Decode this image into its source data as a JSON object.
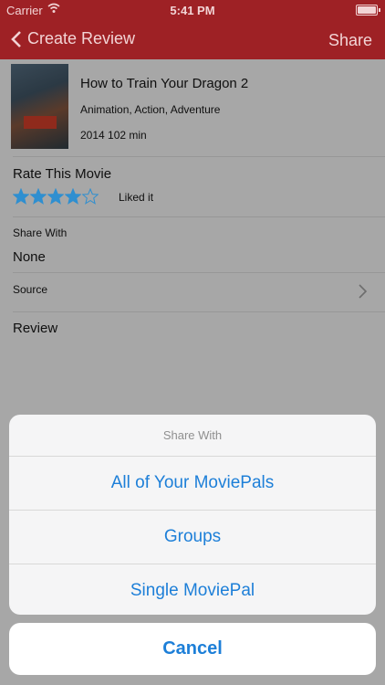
{
  "status_bar": {
    "carrier": "Carrier",
    "time": "5:41 PM"
  },
  "nav": {
    "back_label": "Create Review",
    "share_label": "Share"
  },
  "movie": {
    "title": "How to Train Your Dragon 2",
    "genres": "Animation, Action, Adventure",
    "meta": "2014 102 min"
  },
  "rating": {
    "label": "Rate This Movie",
    "value": 4,
    "max": 5,
    "text": "Liked it"
  },
  "share_with": {
    "label": "Share With",
    "value": "None"
  },
  "source": {
    "label": "Source"
  },
  "review": {
    "label": "Review"
  },
  "action_sheet": {
    "title": "Share With",
    "options": [
      "All of Your MoviePals",
      "Groups",
      "Single MoviePal"
    ],
    "cancel": "Cancel"
  },
  "colors": {
    "accent": "#1d7fd8",
    "nav_bg": "#c8282e",
    "star": "#2f8fd0"
  }
}
